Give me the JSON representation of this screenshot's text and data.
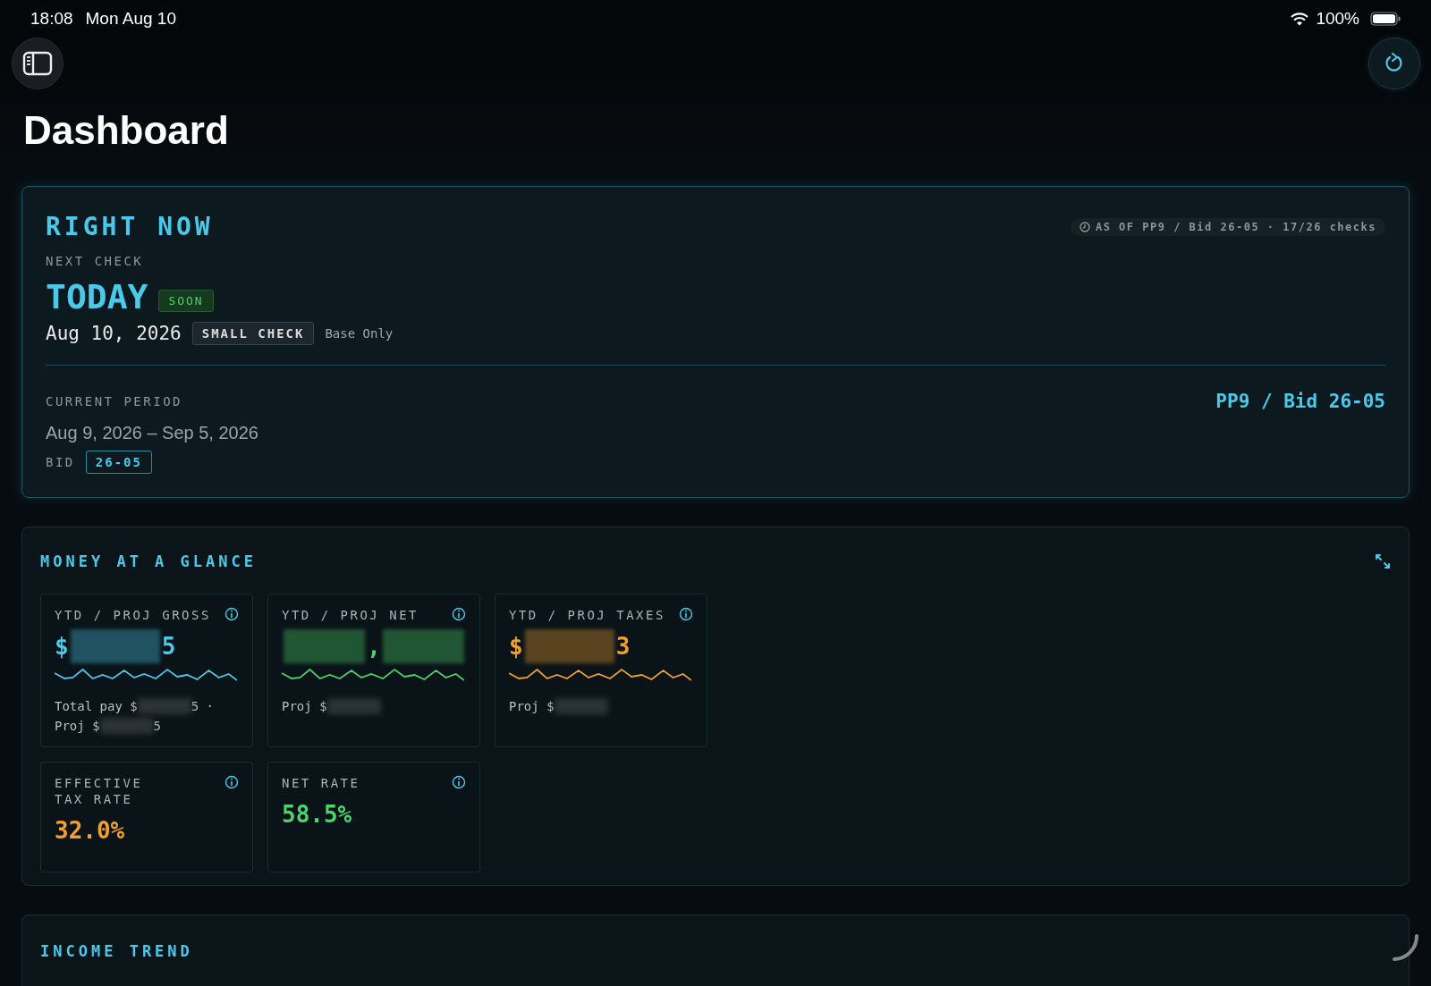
{
  "status_bar": {
    "time": "18:08",
    "date": "Mon Aug 10",
    "battery": "100%"
  },
  "title": "Dashboard",
  "right_now": {
    "heading": "RIGHT NOW",
    "as_of": "AS OF PP9 / Bid 26-05 · 17/26 checks",
    "next_check_label": "NEXT CHECK",
    "next_check": "TODAY",
    "badge": "SOON",
    "date": "Aug 10, 2026",
    "check_type": "SMALL CHECK",
    "check_note": "Base Only",
    "period_label": "CURRENT PERIOD",
    "period": "Aug 9, 2026 – Sep 5, 2026",
    "period_code": "PP9 / Bid 26-05",
    "bid_label": "BID",
    "bid": "26-05"
  },
  "money": {
    "heading": "MONEY AT A GLANCE",
    "metrics": [
      {
        "label": "YTD / PROJ GROSS",
        "kind": "amount",
        "color": "#4cc9e8",
        "value": [
          {
            "kind": "text",
            "text": "$"
          },
          {
            "kind": "redacted"
          },
          {
            "kind": "text",
            "text": "5"
          }
        ],
        "lines": [
          [
            {
              "kind": "text",
              "text": "Total pay $"
            },
            {
              "kind": "redacted"
            },
            {
              "kind": "text",
              "text": "5 ·"
            }
          ],
          [
            {
              "kind": "text",
              "text": "Proj $"
            },
            {
              "kind": "redacted"
            },
            {
              "kind": "text",
              "text": "5"
            }
          ]
        ]
      },
      {
        "label": "YTD / PROJ NET",
        "kind": "amount",
        "color": "#4ed36a",
        "value": [
          {
            "kind": "redacted"
          },
          {
            "kind": "text",
            "text": ","
          },
          {
            "kind": "redacted"
          }
        ],
        "lines": [
          [
            {
              "kind": "text",
              "text": "Proj $"
            },
            {
              "kind": "redacted"
            }
          ]
        ]
      },
      {
        "label": "YTD / PROJ TAXES",
        "kind": "amount",
        "color": "#f0a030",
        "value": [
          {
            "kind": "text",
            "text": "$"
          },
          {
            "kind": "redacted"
          },
          {
            "kind": "text",
            "text": "3"
          }
        ],
        "lines": [
          [
            {
              "kind": "text",
              "text": "Proj $"
            },
            {
              "kind": "redacted"
            }
          ]
        ]
      },
      {
        "label": "EFFECTIVE TAX RATE",
        "kind": "rate",
        "color": "#f0a030",
        "value": [
          {
            "kind": "text",
            "text": "32.0%"
          }
        ]
      },
      {
        "label": "NET RATE",
        "kind": "rate",
        "color": "#4ed36a",
        "value": [
          {
            "kind": "text",
            "text": "58.5%"
          }
        ]
      }
    ]
  },
  "income_trend": {
    "heading": "INCOME TREND"
  }
}
